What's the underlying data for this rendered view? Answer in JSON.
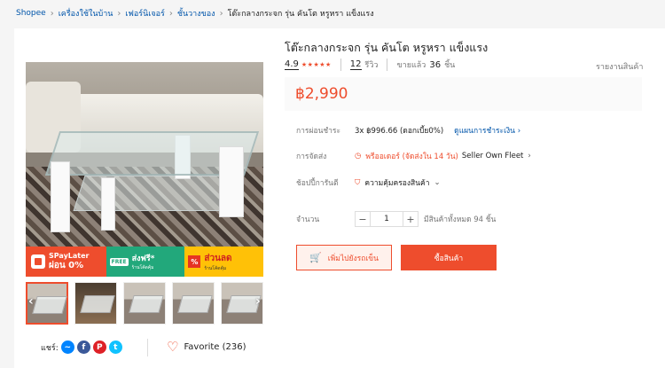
{
  "breadcrumb": {
    "items": [
      "Shopee",
      "เครื่องใช้ในบ้าน",
      "เฟอร์นิเจอร์",
      "ชั้นวางของ"
    ],
    "current": "โต๊ะกลางกระจก รุ่น คันโต หรูหรา แข็งแรง"
  },
  "gallery": {
    "promo": {
      "spay_line1": "SPayLater",
      "spay_line2": "ผ่อน 0%",
      "free_tag": "FREE",
      "free_main": "ส่งฟรี*",
      "free_sub": "ร้านโค้ดคุ้ม",
      "discount_tag": "%",
      "discount_main": "ส่วนลด",
      "discount_sub": "ร้านโค้ดคุ้ม"
    },
    "thumbnail_count": 5,
    "prev_arrow": "‹",
    "next_arrow": "›"
  },
  "social": {
    "share_label": "แชร์:",
    "icons": [
      "messenger-icon",
      "facebook-icon",
      "pinterest-icon",
      "twitter-icon"
    ],
    "favorite_label": "Favorite (236)"
  },
  "product": {
    "title": "โต๊ะกลางกระจก รุ่น คันโต หรูหรา แข็งแรง",
    "rating": "4.9",
    "stars": "★★★★★",
    "reviews_count": "12",
    "reviews_label": "รีวิว",
    "sold_label": "ขายแล้ว",
    "sold_count": "36",
    "sold_unit": "ชิ้น",
    "report_label": "รายงานสินค้า",
    "price": "฿2,990"
  },
  "details": {
    "installment": {
      "label": "การผ่อนชำระ",
      "value": "3x ฿996.66 (ดอกเบี้ย0%)",
      "link": "ดูแผนการชำระเงิน"
    },
    "shipping": {
      "label": "การจัดส่ง",
      "value": "พรีออเดอร์ (จัดส่งใน 14 วัน)",
      "fleet": "Seller Own Fleet"
    },
    "warranty": {
      "label": "ช้อปปี้การันตี",
      "value": "ความคุ้มครองสินค้า"
    },
    "quantity": {
      "label": "จำนวน",
      "value": "1",
      "minus": "−",
      "plus": "+",
      "available": "มีสินค้าทั้งหมด 94 ชิ้น"
    }
  },
  "actions": {
    "add_to_cart": "เพิ่มไปยังรถเข็น",
    "buy_now": "ซื้อสินค้า"
  },
  "colors": {
    "accent": "#ee4d2d",
    "link": "#0055aa"
  }
}
